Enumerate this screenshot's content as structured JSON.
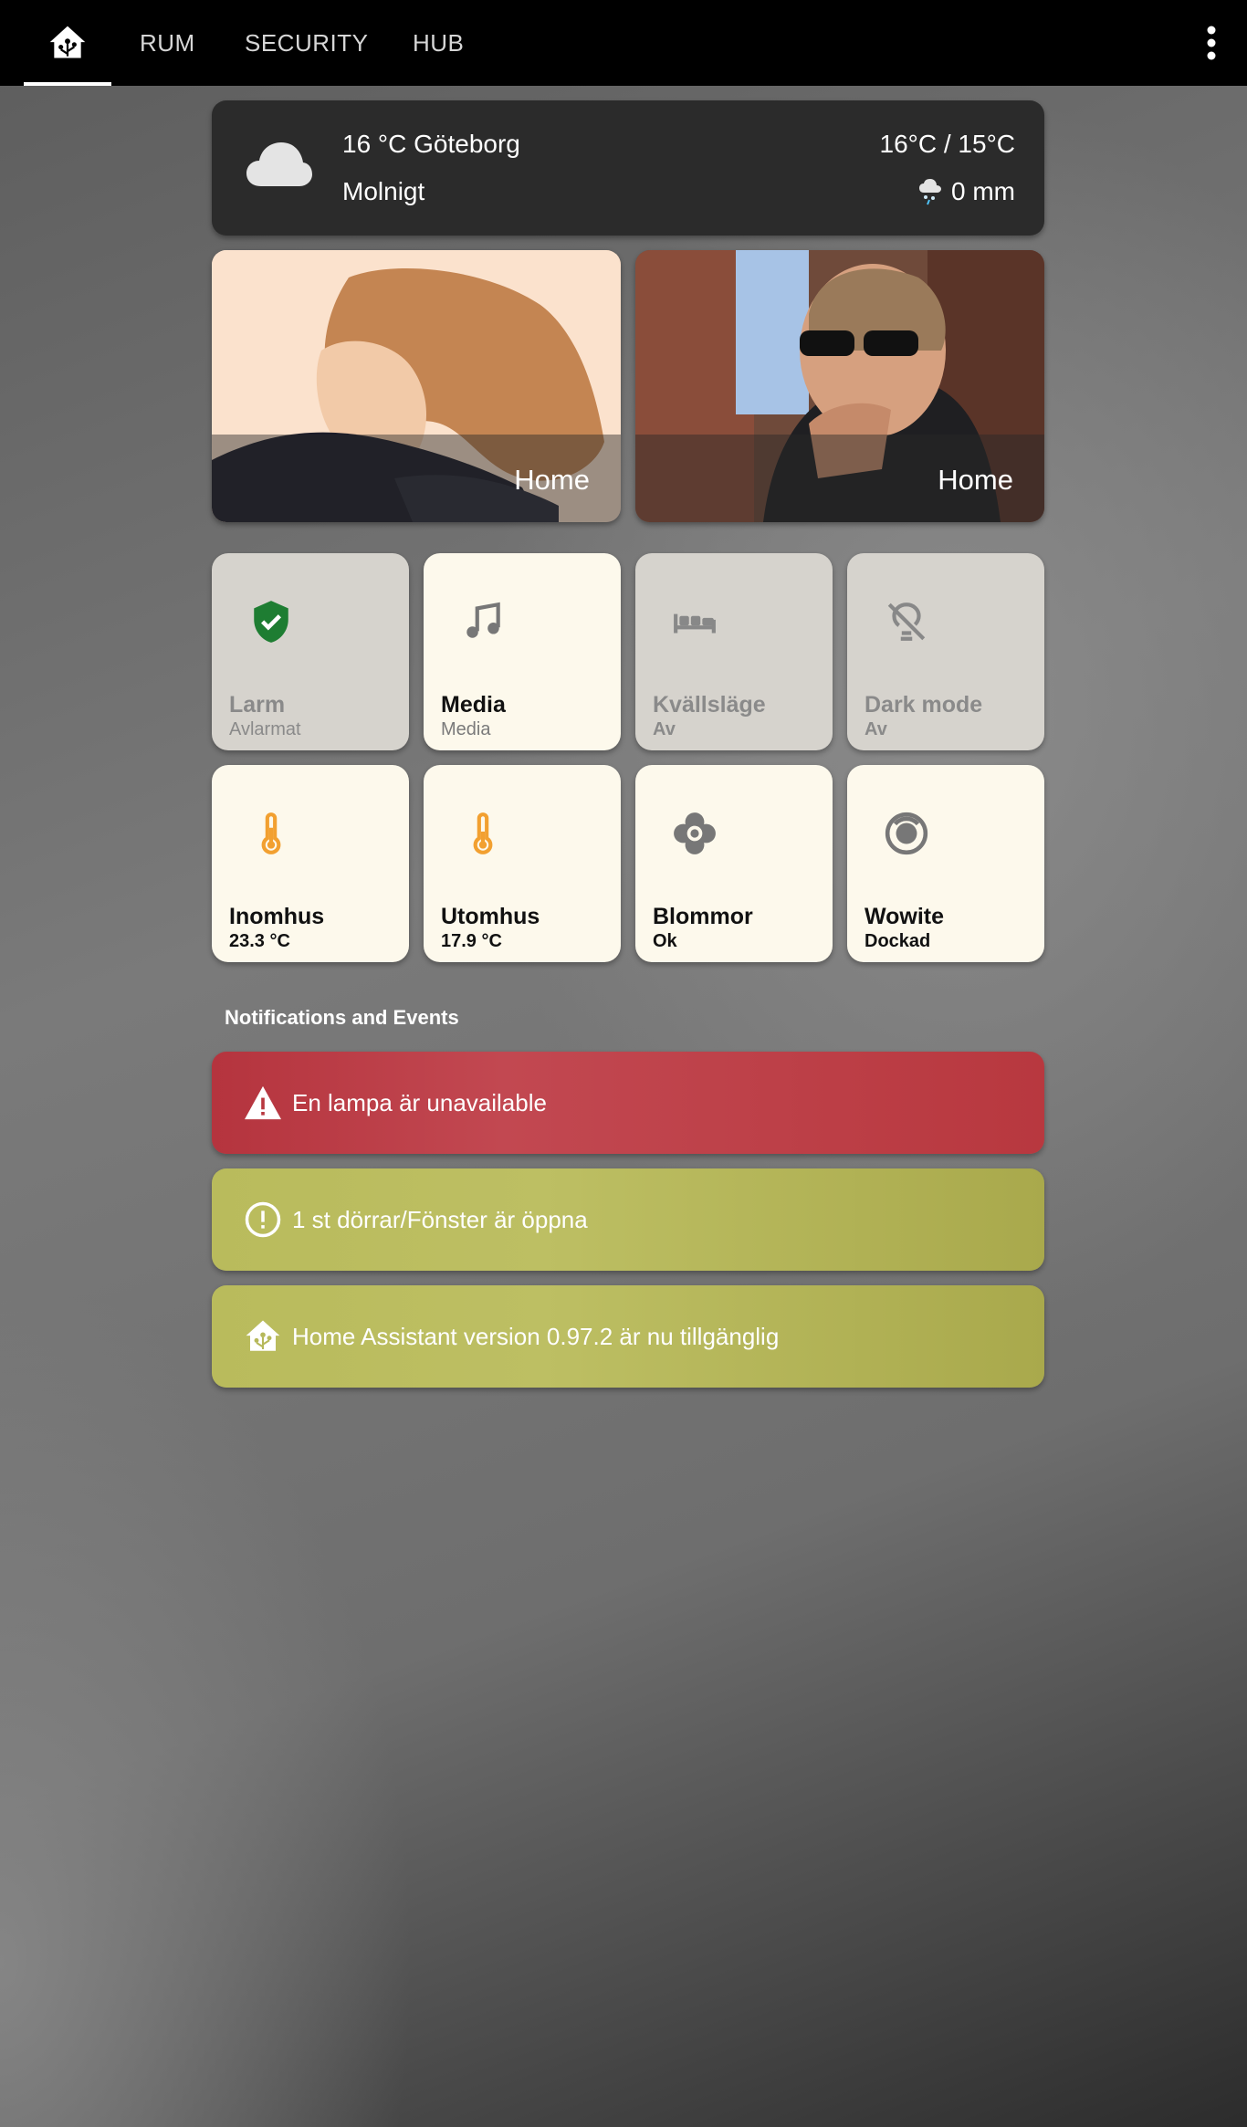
{
  "topbar": {
    "home_icon": "home-assistant-icon",
    "tabs": [
      "RUM",
      "SECURITY",
      "HUB"
    ],
    "menu_icon": "more-vertical-icon"
  },
  "weather": {
    "icon": "cloud-icon",
    "temp_location": "16 °C Göteborg",
    "condition": "Molnigt",
    "high_low": "16°C / 15°C",
    "precip_icon": "weather-snowy-rainy-icon",
    "precipitation": "0 mm"
  },
  "persons": [
    {
      "state": "Home"
    },
    {
      "state": "Home"
    }
  ],
  "tiles": [
    {
      "name": "Larm",
      "state": "Avlarmat",
      "icon": "shield-check-icon",
      "on": true
    },
    {
      "name": "Media",
      "state": "Media",
      "icon": "music-note-icon",
      "on": true
    },
    {
      "name": "Kvällsläge",
      "state": "Av",
      "icon": "bed-icon",
      "on": false
    },
    {
      "name": "Dark mode",
      "state": "Av",
      "icon": "lightbulb-off-icon",
      "on": false
    },
    {
      "name": "Inomhus",
      "state": "23.3 °C",
      "icon": "thermometer-icon",
      "on": true
    },
    {
      "name": "Utomhus",
      "state": "17.9 °C",
      "icon": "thermometer-icon",
      "on": true
    },
    {
      "name": "Blommor",
      "state": "Ok",
      "icon": "flower-icon",
      "on": true
    },
    {
      "name": "Wowite",
      "state": "Dockad",
      "icon": "robot-vacuum-icon",
      "on": true
    }
  ],
  "notifications_title": "Notifications and Events",
  "notifications": [
    {
      "text": "En lampa är unavailable",
      "icon": "alert-triangle-icon",
      "color": "#b8383f"
    },
    {
      "text": "1 st dörrar/Fönster är öppna",
      "icon": "alert-circle-icon",
      "color": "#b9bb5c"
    },
    {
      "text": "Home Assistant version 0.97.2 är nu tillgänglig",
      "icon": "home-assistant-icon",
      "color": "#b9bb5c"
    }
  ]
}
